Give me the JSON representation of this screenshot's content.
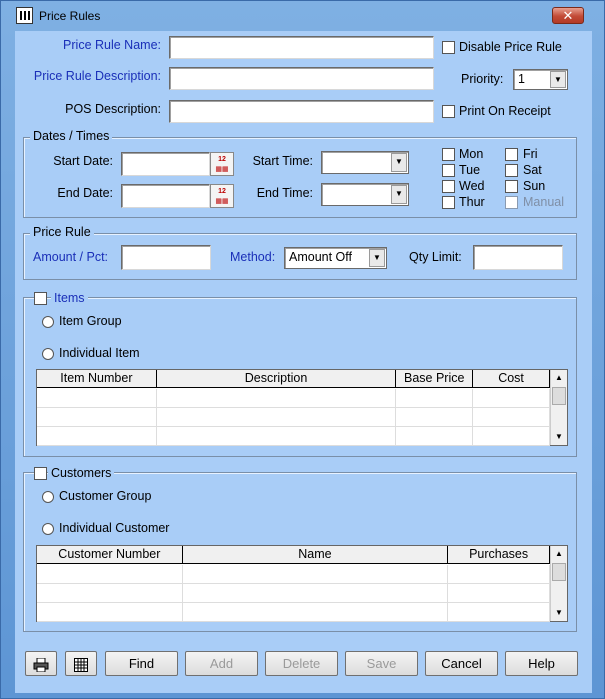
{
  "window": {
    "title": "Price Rules",
    "close_glyph": "✕"
  },
  "form": {
    "price_rule_name_label": "Price Rule Name:",
    "price_rule_name_value": "",
    "price_rule_description_label": "Price Rule Description:",
    "price_rule_description_value": "",
    "pos_description_label": "POS Description:",
    "pos_description_value": "",
    "disable_price_rule_label": "Disable Price Rule",
    "priority_label": "Priority:",
    "priority_value": "1",
    "print_on_receipt_label": "Print On Receipt"
  },
  "dates_times": {
    "legend": "Dates / Times",
    "start_date_label": "Start Date:",
    "end_date_label": "End Date:",
    "start_time_label": "Start Time:",
    "end_time_label": "End Time:",
    "days": {
      "mon": "Mon",
      "tue": "Tue",
      "wed": "Wed",
      "thur": "Thur",
      "fri": "Fri",
      "sat": "Sat",
      "sun": "Sun",
      "manual": "Manual"
    }
  },
  "price_rule": {
    "legend": "Price Rule",
    "amount_pct_label": "Amount / Pct:",
    "method_label": "Method:",
    "method_value": "Amount Off",
    "qty_limit_label": "Qty Limit:"
  },
  "items": {
    "legend": "Items",
    "item_group_label": "Item Group",
    "individual_item_label": "Individual Item",
    "columns": [
      "Item Number",
      "Description",
      "Base Price",
      "Cost"
    ]
  },
  "customers": {
    "legend": "Customers",
    "customer_group_label": "Customer Group",
    "individual_customer_label": "Individual Customer",
    "columns": [
      "Customer Number",
      "Name",
      "Purchases"
    ]
  },
  "toolbar": {
    "print_icon": "printer-icon",
    "grid_icon": "grid-icon",
    "find": "Find",
    "add": "Add",
    "delete": "Delete",
    "save": "Save",
    "cancel": "Cancel",
    "help": "Help"
  },
  "colors": {
    "client_bg": "#a9cdf7",
    "label_blue": "#1a2fb8"
  }
}
